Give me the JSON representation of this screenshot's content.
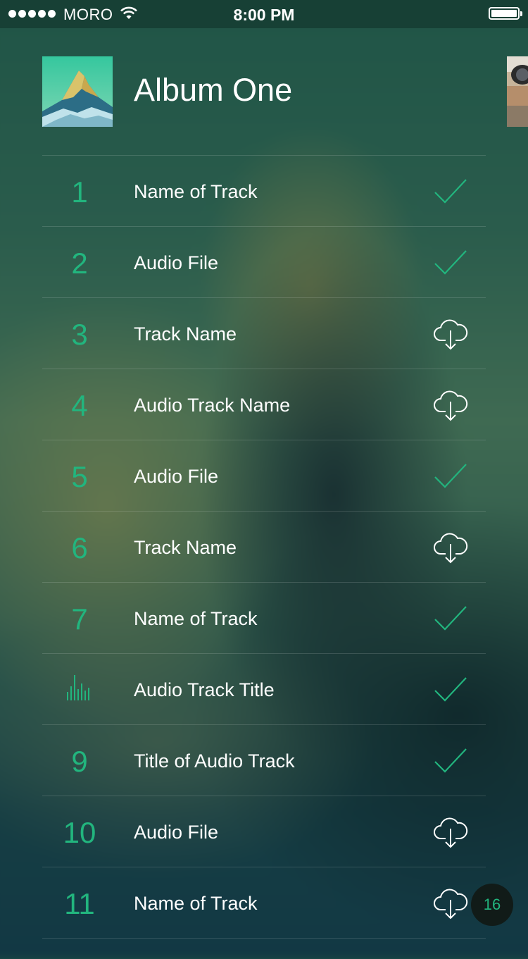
{
  "status_bar": {
    "carrier": "MORO",
    "time": "8:00 PM"
  },
  "album": {
    "title": "Album One"
  },
  "tracks": [
    {
      "number": "1",
      "name": "Name of Track",
      "status": "downloaded"
    },
    {
      "number": "2",
      "name": "Audio File",
      "status": "downloaded"
    },
    {
      "number": "3",
      "name": "Track Name",
      "status": "download"
    },
    {
      "number": "4",
      "name": "Audio Track Name",
      "status": "download"
    },
    {
      "number": "5",
      "name": "Audio File",
      "status": "downloaded"
    },
    {
      "number": "6",
      "name": "Track Name",
      "status": "download"
    },
    {
      "number": "7",
      "name": "Name of Track",
      "status": "downloaded"
    },
    {
      "number": "",
      "name": "Audio Track Title",
      "status": "downloaded",
      "playing": true
    },
    {
      "number": "9",
      "name": "Title of Audio Track",
      "status": "downloaded"
    },
    {
      "number": "10",
      "name": "Audio File",
      "status": "download"
    },
    {
      "number": "11",
      "name": "Name of Track",
      "status": "download"
    }
  ],
  "badge": {
    "count": "16"
  },
  "colors": {
    "accent": "#22b57e",
    "background": "#1f4f44"
  },
  "icons": {
    "downloaded": "checkmark-icon",
    "download": "cloud-download-icon",
    "playing": "equalizer-icon"
  }
}
